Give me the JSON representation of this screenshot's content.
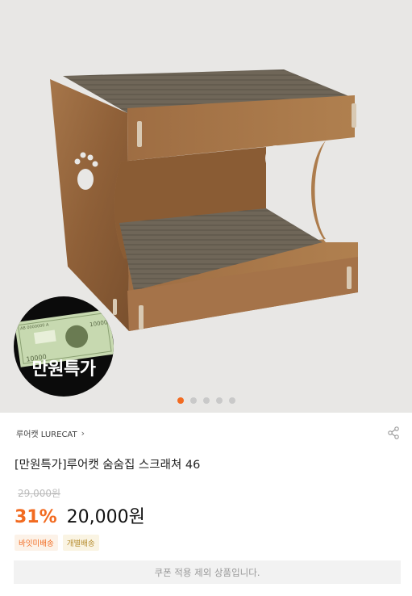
{
  "hero": {
    "product_image_label": "cat-scratcher-house-image",
    "badge": {
      "text": "만원특가",
      "banknote_serial": "AB 0000000 A",
      "banknote_value_top": "10000",
      "banknote_value_bottom": "10000"
    },
    "carousel": {
      "count": 5,
      "active_index": 0,
      "active_color": "#f26b21"
    }
  },
  "product": {
    "brand": "루어캣 LURECAT",
    "title": "[만원특가]루어캣 숨숨집 스크래쳐 46",
    "original_price": "29,000원",
    "discount": "31%",
    "price": "20,000원",
    "tags": [
      "바잇미배송",
      "개별배송"
    ],
    "coupon_notice": "쿠폰 적용 제외 상품입니다."
  },
  "colors": {
    "accent": "#f26b21"
  },
  "icons": {
    "share": "share-icon",
    "brand_chevron": "chevron-right-icon"
  }
}
